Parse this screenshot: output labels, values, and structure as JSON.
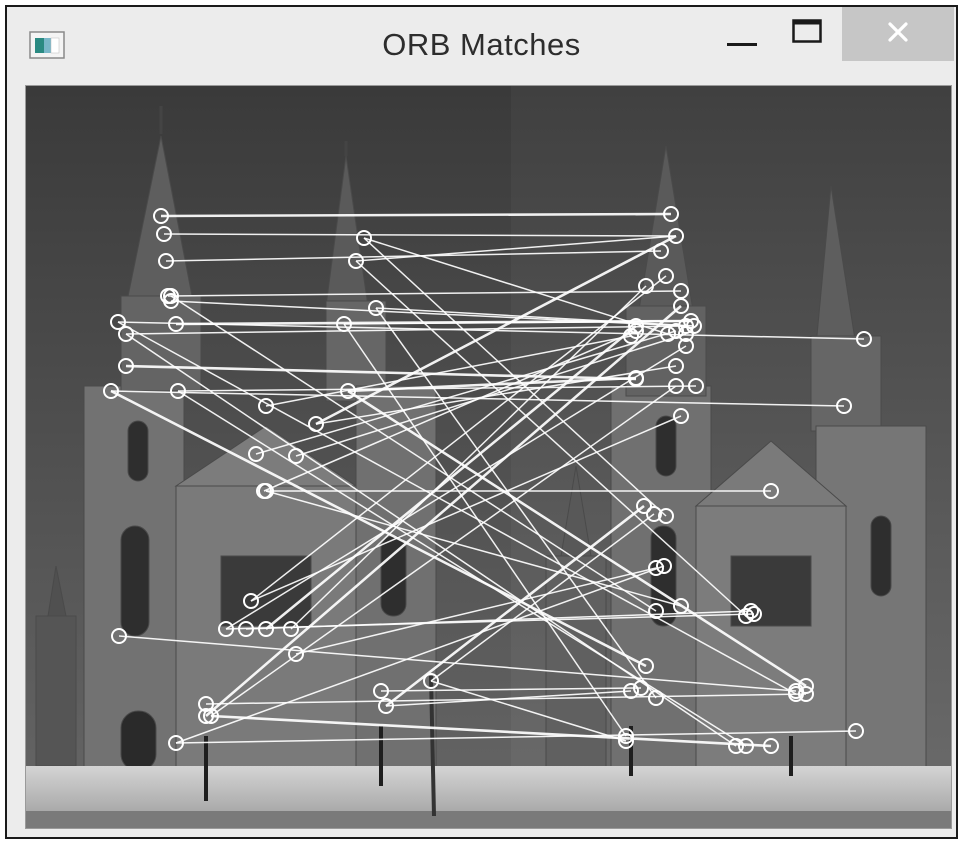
{
  "window": {
    "title": "ORB Matches",
    "controls": {
      "minimize_icon": "minimize-icon",
      "maximize_icon": "maximize-icon",
      "close_icon": "close-icon"
    }
  },
  "colors": {
    "titlebar": "#ececec",
    "title_text": "#2d2d2d",
    "close_button_bg": "#c6c6c6",
    "match_line": "#ffffff",
    "sky_top": "#4a4a4a",
    "sky_bottom": "#6a6a6a",
    "building": "#7a7a7a"
  }
}
